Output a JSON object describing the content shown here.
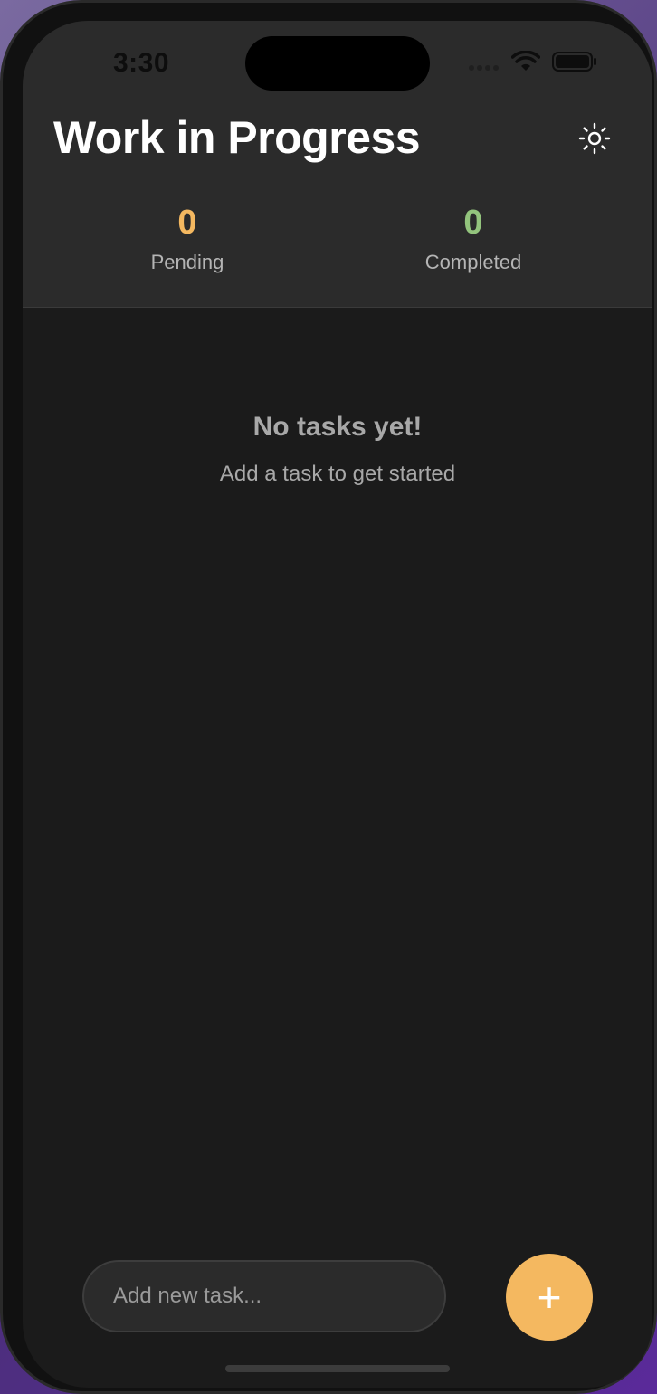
{
  "status_bar": {
    "time": "3:30"
  },
  "header": {
    "title": "Work in Progress",
    "theme_toggle_icon": "sun-icon"
  },
  "stats": {
    "pending": {
      "value": "0",
      "label": "Pending",
      "color": "#f4b860"
    },
    "completed": {
      "value": "0",
      "label": "Completed",
      "color": "#93c47d"
    }
  },
  "empty_state": {
    "title": "No tasks yet!",
    "subtitle": "Add a task to get started"
  },
  "composer": {
    "placeholder": "Add new task...",
    "value": "",
    "add_button_label": "+",
    "accent": "#f4b860"
  }
}
